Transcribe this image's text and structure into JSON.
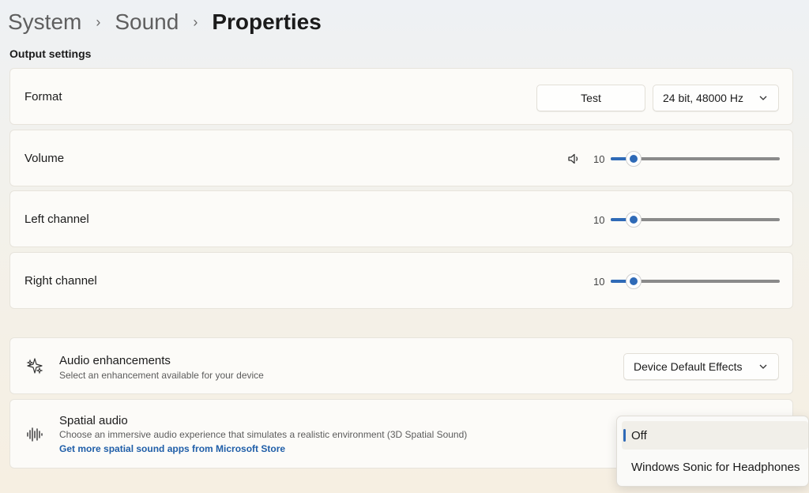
{
  "breadcrumb": [
    "System",
    "Sound",
    "Properties"
  ],
  "output_settings": {
    "section_title": "Output settings",
    "format": {
      "label": "Format",
      "test_label": "Test",
      "selected": "24 bit, 48000 Hz"
    },
    "volume": {
      "label": "Volume",
      "value": "10",
      "level": 0.1
    },
    "left_channel": {
      "label": "Left channel",
      "value": "10",
      "level": 0.1
    },
    "right_channel": {
      "label": "Right channel",
      "value": "10",
      "level": 0.1
    }
  },
  "audio_enhancements": {
    "title": "Audio enhancements",
    "description": "Select an enhancement available for your device",
    "selected": "Device Default Effects"
  },
  "spatial_audio": {
    "title": "Spatial audio",
    "description": "Choose an immersive audio experience that simulates a realistic environment (3D Spatial Sound)",
    "link": "Get more spatial sound apps from Microsoft Store",
    "options": [
      "Off",
      "Windows Sonic for Headphones"
    ],
    "selected_index": 0
  },
  "colors": {
    "accent": "#2f6ab7",
    "link": "#1f5ea8"
  },
  "icons": [
    "chevron-right-icon",
    "chevron-down-icon",
    "speaker-icon",
    "enhancements-sparkle-icon",
    "soundwave-icon"
  ]
}
